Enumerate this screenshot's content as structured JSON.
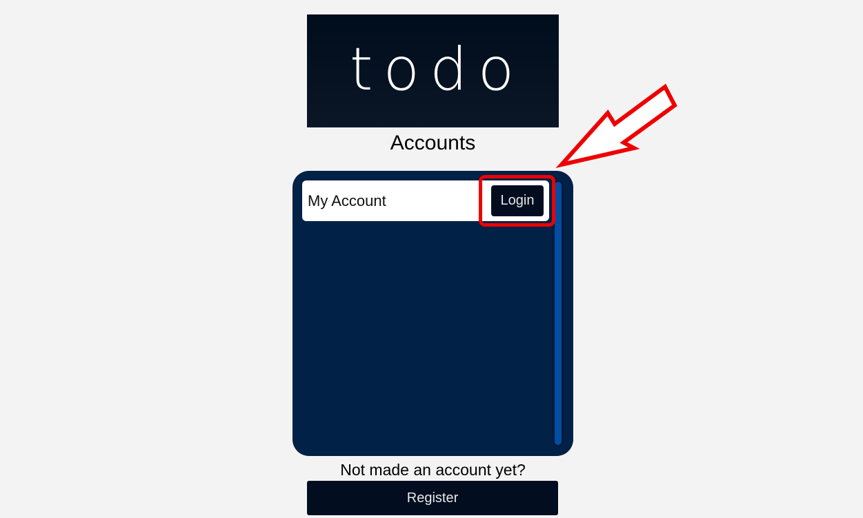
{
  "logo": {
    "text": "todo"
  },
  "page": {
    "title": "Accounts"
  },
  "accounts": {
    "items": [
      {
        "name": "My Account",
        "login_label": "Login"
      }
    ]
  },
  "footer": {
    "prompt": "Not made an account yet?",
    "register_label": "Register"
  },
  "colors": {
    "background": "#f3f3f3",
    "logo_bg": "#0b1626",
    "panel_bg": "#012147",
    "scrollbar_thumb": "#034da3",
    "button_bg": "#020d1f",
    "annotation": "#ee0000"
  },
  "annotation": {
    "shape": "arrow-icon",
    "highlight": "highlight-box"
  }
}
